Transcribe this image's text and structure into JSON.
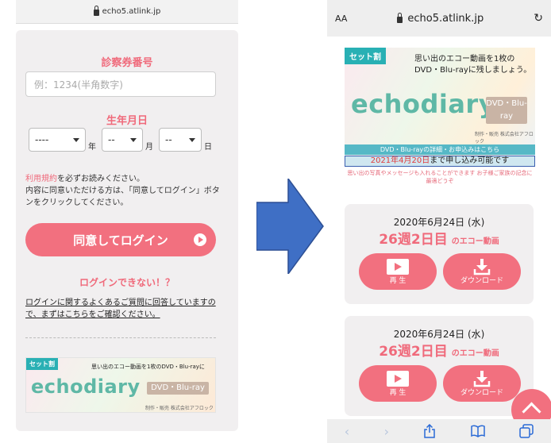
{
  "left": {
    "url": "echo5.atlink.jp",
    "ticket_label": "診察券番号",
    "ticket_placeholder": "例：1234(半角数字)",
    "dob_label": "生年月日",
    "year_value": "----",
    "month_value": "--",
    "day_value": "--",
    "unit_year": "年",
    "unit_month": "月",
    "unit_day": "日",
    "terms_link": "利用規約",
    "terms_line1_rest": "を必ずお読みください。",
    "terms_line2": "内容に同意いただける方は、「同意してログイン」ボタンをクリックしてください。",
    "login_button": "同意してログイン",
    "cant_login": "ログインできない！？",
    "faq_text": "ログインに関するよくあるご質問に回答していますので、まずはこちらをご確認ください。",
    "banner": {
      "tag": "セット割",
      "tagline": "思い出のエコー動画を1枚のDVD・Blu-rayに",
      "logo": "echodiary",
      "chip": "DVD・Blu-ray",
      "maker": "制作・販売 株式会社アフロック"
    }
  },
  "right": {
    "aa": "AA",
    "url": "echo5.atlink.jp",
    "banner": {
      "tag": "セット割",
      "tagline": "思い出のエコー動画を1枚のDVD・Blu-rayに残しましょう。",
      "logo": "echodiary",
      "chip": "DVD・Blu-ray",
      "maker": "制作・販売 株式会社アフロック",
      "bar": "DVD・Blu-rayの詳細・お申込みはこちら",
      "date_red": "2021年4月20日",
      "date_rest": "まで申し込み可能です",
      "note": "思い出の写真やメッセージも入れることができます お子様ご家族の記念に最適どうぞ"
    },
    "cards": [
      {
        "date": "2020年6月24日 (水)",
        "age_big": "26週2日目",
        "age_small": "のエコー動画",
        "play_label": "再 生",
        "download_label": "ダウンロード"
      },
      {
        "date": "2020年6月24日 (水)",
        "age_big": "26週2日目",
        "age_small": "のエコー動画",
        "play_label": "再 生",
        "download_label": "ダウンロード"
      }
    ],
    "toolbar": {
      "back_icon": "chevron-left",
      "forward_icon": "chevron-right",
      "share_icon": "share",
      "bookmarks_icon": "book",
      "tabs_icon": "tabs"
    }
  },
  "colors": {
    "accent_pink": "#f2707f",
    "arrow_blue": "#3f6fc5",
    "teal": "#56b8c6"
  }
}
